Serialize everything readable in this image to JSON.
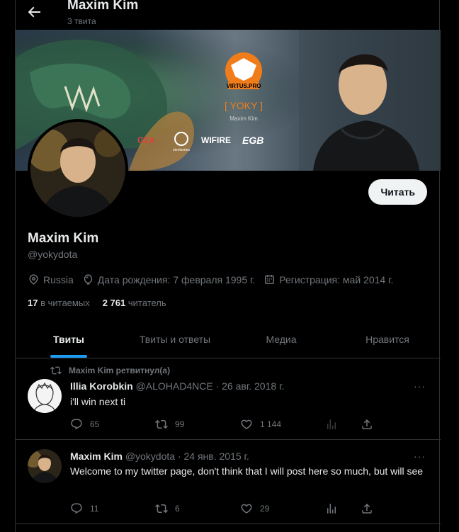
{
  "header": {
    "name": "Maxim Kim",
    "tweet_count": "3 твита"
  },
  "banner": {
    "logo_text": "VIRTUS.PRO",
    "player_tag": "[  YOKY  ]",
    "player_name": "Maxim Kim",
    "sponsors": [
      "G2A",
      "steelseries",
      "WIFIRE",
      "EGB"
    ]
  },
  "profile": {
    "name": "Maxim Kim",
    "handle": "@yokydota",
    "follow_label": "Читать",
    "location": "Russia",
    "birthday": "Дата рождения: 7 февраля 1995 г.",
    "joined": "Регистрация: май 2014 г.",
    "following_count": "17",
    "following_label": "в читаемых",
    "followers_count": "2 761",
    "followers_label": "читатель"
  },
  "tabs": [
    {
      "label": "Твиты",
      "active": true
    },
    {
      "label": "Твиты и ответы",
      "active": false
    },
    {
      "label": "Медиа",
      "active": false
    },
    {
      "label": "Нравится",
      "active": false
    }
  ],
  "tweets": [
    {
      "retweet_label": "Maxim Kim ретвитнул(а)",
      "name": "Illia Korobkin",
      "handle_date": "@ALOHAD4NCE · 26 авг. 2018 г.",
      "text": "i'll win next ti",
      "replies": "65",
      "retweets": "99",
      "likes": "1 144"
    },
    {
      "name": "Maxim Kim",
      "handle_date": "@yokydota · 24 янв. 2015 г.",
      "text": "Welcome to my twitter page, don't think that I will post here so much, but will see",
      "replies": "11",
      "retweets": "6",
      "likes": "29"
    }
  ],
  "more_label": "···",
  "colors": {
    "accent": "#1d9bf0",
    "background": "#000000",
    "muted": "#71767b",
    "text": "#e7e9ea"
  }
}
